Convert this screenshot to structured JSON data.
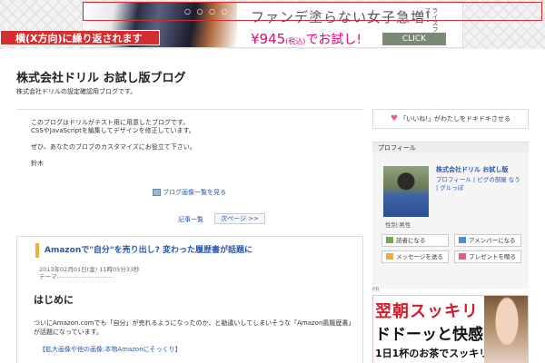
{
  "ad": {
    "product_dots": "○ ○ ○ ○",
    "title": "ファンデ塗らない女子急増!",
    "price_main": "¥945",
    "price_tax": "(税込)",
    "price_rest": "でお試し!",
    "brand": "ライスフォース",
    "click": "CLICK"
  },
  "annotation": {
    "label": "横(X方向)に繰り返されます",
    "color": "#d03030"
  },
  "blog": {
    "title": "株式会社ドリル お試し版ブログ",
    "subtitle": "株式会社ドリルの設定確認用ブログです。"
  },
  "intro": {
    "line1": "このブログはドリルがテスト用に用意したブログです。",
    "line2": "CSSやJavaScriptを編集してデザインを修正しています。",
    "line3": "ぜひ、あなたのブロブのカスタマイズにお役立て下さい。",
    "line4": "鈴木"
  },
  "links": {
    "image_list": "ブログ画像一覧を見る",
    "article_list": "記事一覧",
    "next_page": "次ページ >>"
  },
  "entry": {
    "title": "Amazonで\"自分\"を売り出し? 変わった履歴書が話題に",
    "date": "2013年02月01日(金) 11時05分33秒",
    "theme": "テーマ:",
    "heading": "はじめに",
    "body": "ついにAmazon.comでも「自分」が売れるようになったのか、と勘違いしてしまいそうな「Amazon風履歴書」が話題になっています。",
    "link": "【拡大画像や他の画像:本物Amazonにそっくり】"
  },
  "sidebar": {
    "like": "「いいね!」がわたしをドキドキさせる",
    "profile_header": "プロフィール",
    "profile_name": "株式会社ドリル お試し版",
    "profile_links": "プロフィール | ピグの部屋 なう | グルっぽ",
    "gender": "性別:男性",
    "buttons": {
      "reader": "読者になる",
      "ameba": "アメンバーになる",
      "message": "メッセージを送る",
      "present": "プレゼントを贈る"
    },
    "pr": "PR",
    "pr_ad": {
      "red": "翌朝スッキリ",
      "mid": "ドドーッと快感!!",
      "small": "1日1杯のお茶でスッキリ"
    }
  },
  "colors": {
    "link": "#2a57b0",
    "accent": "#f0b030",
    "heart": "#e85a8a",
    "pr_red": "#d7192a"
  }
}
